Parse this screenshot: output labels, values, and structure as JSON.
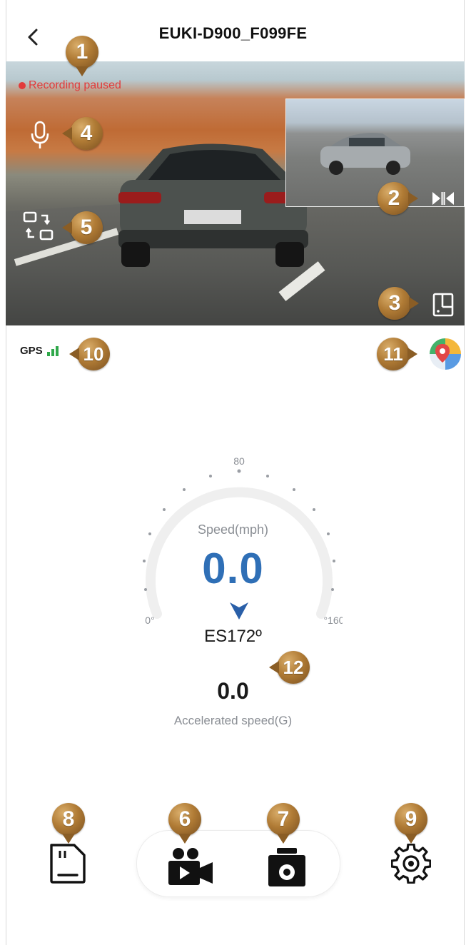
{
  "header": {
    "title": "EUKI-D900_F099FE",
    "back_icon": "chevron-left-icon"
  },
  "camera": {
    "status": "Recording paused",
    "status_color": "#e23a3a",
    "icons": [
      "microphone-icon",
      "switch-camera-icon",
      "swap-view-icon",
      "fullscreen-icon"
    ]
  },
  "gps": {
    "label": "GPS",
    "signal_color": "#2fa84a"
  },
  "speedometer": {
    "tick_top": "80",
    "tick_min": "0°",
    "tick_max": "°160",
    "label": "Speed(mph)",
    "value": "0.0",
    "value_color": "#2f6fb6",
    "heading": "ES172º",
    "accel_value": "0.0",
    "accel_label": "Accelerated speed(G)"
  },
  "badges": [
    "1",
    "2",
    "3",
    "4",
    "5",
    "6",
    "7",
    "8",
    "9",
    "10",
    "11",
    "12"
  ],
  "bottom": {
    "icons": [
      "sd-card-icon",
      "video-record-icon",
      "camera-snapshot-icon",
      "settings-gear-icon"
    ]
  },
  "accent_color": "#b07b35"
}
